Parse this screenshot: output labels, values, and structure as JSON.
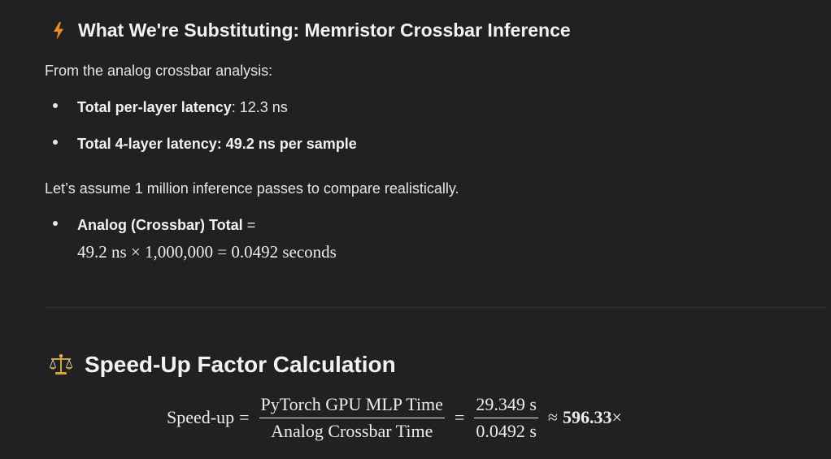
{
  "section1": {
    "icon": "lightning-icon",
    "title": "What We're Substituting: Memristor Crossbar Inference",
    "intro": "From the analog crossbar analysis:",
    "bullets": [
      {
        "label": "Total per-layer latency",
        "sep": ": ",
        "value": "12.3 ns"
      },
      {
        "label": "Total 4-layer latency: 49.2 ns per sample"
      }
    ],
    "assume": "Let’s assume 1 million inference passes to compare realistically.",
    "analog_bullet": {
      "label": "Analog (Crossbar) Total",
      "suffix": " =",
      "math": "49.2 ns × 1,000,000 = 0.0492 seconds"
    }
  },
  "section2": {
    "icon": "balance-scale-icon",
    "title": "Speed-Up Factor Calculation",
    "equation": {
      "lhs": "Speed-up",
      "eq1": "=",
      "frac1_num": "PyTorch GPU MLP Time",
      "frac1_den": "Analog Crossbar Time",
      "eq2": "=",
      "frac2_num": "29.349 s",
      "frac2_den": "0.0492 s",
      "approx": "≈",
      "result": "596.33",
      "times": "×"
    }
  }
}
